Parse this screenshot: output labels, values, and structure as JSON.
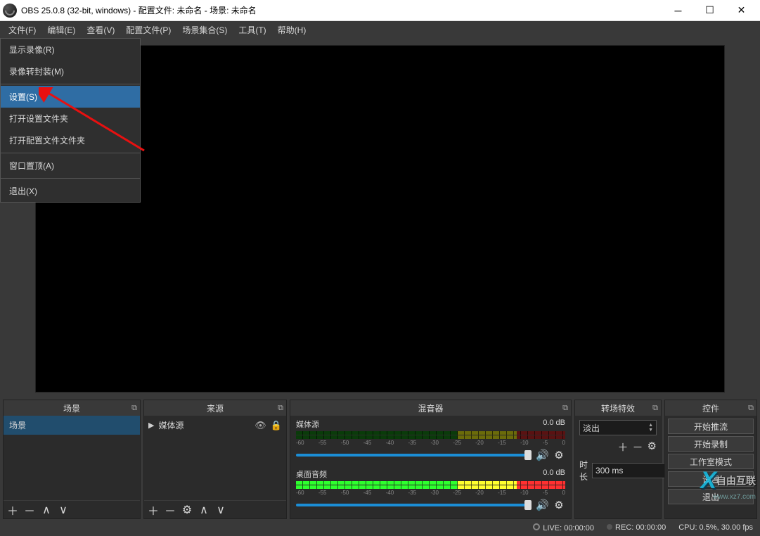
{
  "title": "OBS 25.0.8 (32-bit, windows) - 配置文件: 未命名 - 场景: 未命名",
  "menu": {
    "file": "文件(F)",
    "edit": "编辑(E)",
    "view": "查看(V)",
    "profile": "配置文件(P)",
    "scene_collection": "场景集合(S)",
    "tools": "工具(T)",
    "help": "帮助(H)"
  },
  "file_menu": {
    "show_recordings": "显示录像(R)",
    "remux": "录像转封装(M)",
    "settings": "设置(S)",
    "open_settings_folder": "打开设置文件夹",
    "open_profile_folder": "打开配置文件文件夹",
    "always_on_top": "窗口置顶(A)",
    "exit": "退出(X)"
  },
  "docks": {
    "scenes": {
      "title": "场景",
      "items": [
        "场景"
      ]
    },
    "sources": {
      "title": "来源",
      "items": [
        {
          "name": "媒体源"
        }
      ]
    },
    "mixer": {
      "title": "混音器",
      "items": [
        {
          "name": "媒体源",
          "db": "0.0 dB",
          "ticks": [
            "-60",
            "-55",
            "-50",
            "-45",
            "-40",
            "-35",
            "-30",
            "-25",
            "-20",
            "-15",
            "-10",
            "-5",
            "0"
          ]
        },
        {
          "name": "桌面音频",
          "db": "0.0 dB",
          "ticks": [
            "-60",
            "-55",
            "-50",
            "-45",
            "-40",
            "-35",
            "-30",
            "-25",
            "-20",
            "-15",
            "-10",
            "-5",
            "0"
          ]
        }
      ]
    },
    "transitions": {
      "title": "转场特效",
      "selected": "淡出",
      "duration_label": "时长",
      "duration_value": "300 ms"
    },
    "controls": {
      "title": "控件",
      "buttons": [
        "开始推流",
        "开始录制",
        "工作室模式",
        "设置",
        "退出"
      ]
    }
  },
  "status": {
    "live_label": "LIVE:",
    "live_time": "00:00:00",
    "rec_label": "REC:",
    "rec_time": "00:00:00",
    "cpu": "CPU: 0.5%, 30.00 fps"
  },
  "watermark": {
    "text": "自由互联",
    "url": "www.xz7.com"
  }
}
